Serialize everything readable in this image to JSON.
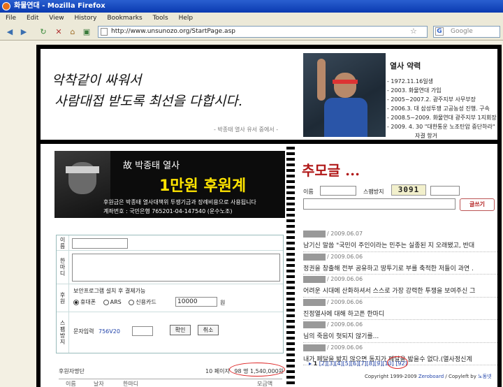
{
  "window": {
    "title": "화물연대 - Mozilla Firefox"
  },
  "menu": [
    "File",
    "Edit",
    "View",
    "History",
    "Bookmarks",
    "Tools",
    "Help"
  ],
  "nav": {
    "url": "http://www.unsunozo.org/StartPage.asp",
    "search_placeholder": "Google",
    "icons": [
      "back-icon",
      "forward-icon",
      "reload-icon",
      "home-icon",
      "bookmark-icon",
      "page-icon",
      "star-icon",
      "google-icon"
    ]
  },
  "banner": {
    "calligraphy_line1": "악착같이 싸워서",
    "calligraphy_line2": "사람대접 받도록 최선을 다합시다.",
    "caption": "- 박종태 열사 유서 중에서 -",
    "profile_title": "열사 약력",
    "profile_items": [
      "- 1972.11.16일생",
      "- 2003. 화물연대 가입",
      "- 2005~2007.2. 광주지부 사무부장",
      "- 2006.3. 대 삼성투쟁 고공농성 진행. 구속",
      "- 2008.5~2009. 화물연대 광주지부 1지회장",
      "- 2009. 4. 30 \"대한통운 노조탄압 중단하라\"",
      "자결 항거"
    ]
  },
  "campaign": {
    "name": "故 박종태 열사",
    "headline": "1만원 후원계",
    "description": "후원금은 박종태 열사대책위 투쟁기금과 장례비용으로 사용됩니다",
    "account": "계좌번호 : 국민은행 765201-04-147540 (운수노조)"
  },
  "donation_form": {
    "name_label": "이름",
    "message_label": "한마디",
    "payment_label": "후원",
    "payment_note": "보안프로그램 설치 후 결제가능",
    "payment_options": [
      "휴대폰",
      "ARS",
      "신용카드"
    ],
    "selected_option": "휴대폰",
    "amount_value": "10000",
    "amount_unit": "원",
    "spam_label": "스팸방지",
    "spam_prompt": "문자입력",
    "spam_code": "756V20",
    "confirm_button": "확인",
    "cancel_button": "취소"
  },
  "sponsors": {
    "header": "후원자명단",
    "pages": "10 페이지",
    "count_total": "98 명 1,540,000원",
    "columns": [
      "이름",
      "날자",
      "한마디",
      "모금액"
    ]
  },
  "memorial": {
    "title": "추모글 ...",
    "name_label": "이름",
    "spam_label": "스팸방지",
    "captcha_code": "3091",
    "write_button": "글쓰기",
    "posts": [
      {
        "date": "/ 2009.06.07",
        "message": "남기신 말씀 \"국민이 주인이라는 민주는 실종된 지 오래됐고, 반대"
      },
      {
        "date": "/ 2009.06.06",
        "message": "정권을 창출해 전부 공유하고 땅투기로 부를 축적한 저들이 과연 ."
      },
      {
        "date": "/ 2009.06.06",
        "message": "어려운 시대에 산화하셔서 스스로 가장 강력한 투쟁을 보여주신 그"
      },
      {
        "date": "/ 2009.06.06",
        "message": "진정열사에 대해 하고픈 한마디"
      },
      {
        "date": "/ 2009.06.06",
        "message": "님의 죽음이 헛되지 않기를..."
      },
      {
        "date": "/ 2009.06.06",
        "message": "내가 페달을 밟지 않으면 동지가 페달을 밟을수 없다.(열사정신계"
      }
    ],
    "pager_current": "1",
    "pager_pages": "[2][3][4][5][6][7][8][9][10]",
    "pager_last": "[92]",
    "copyright_prefix": "Copyright 1999-2009",
    "copyright_link": "Zeroboard",
    "copyleft_prefix": "/ Copyleft by",
    "copyleft_link": "노동넷"
  }
}
